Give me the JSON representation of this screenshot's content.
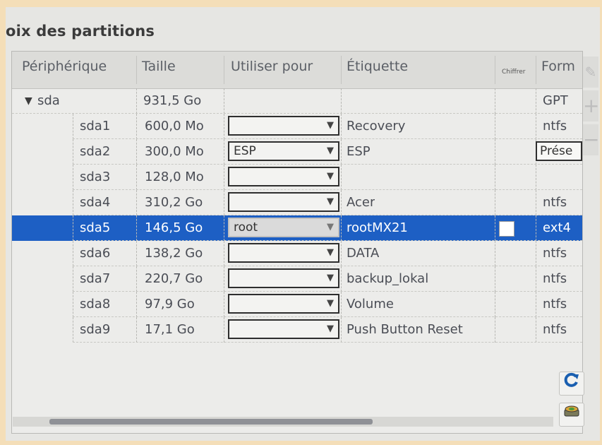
{
  "page_title": "oix des partitions",
  "columns": {
    "device": "Périphérique",
    "size": "Taille",
    "use_for": "Utiliser pour",
    "label": "Étiquette",
    "encrypt": "Chiffrer",
    "format": "Form"
  },
  "disk": {
    "expander": "▼",
    "name": "sda",
    "size": "931,5 Go",
    "format": "GPT"
  },
  "partitions": [
    {
      "name": "sda1",
      "size": "600,0 Mo",
      "use_for": "",
      "label": "Recovery",
      "format": "ntfs"
    },
    {
      "name": "sda2",
      "size": "300,0 Mo",
      "use_for": "ESP",
      "label": "ESP",
      "format": "Prése"
    },
    {
      "name": "sda3",
      "size": "128,0 Mo",
      "use_for": "",
      "label": "",
      "format": ""
    },
    {
      "name": "sda4",
      "size": "310,2 Go",
      "use_for": "",
      "label": "Acer",
      "format": "ntfs"
    },
    {
      "name": "sda5",
      "size": "146,5 Go",
      "use_for": "root",
      "label": "rootMX21",
      "format": "ext4",
      "selected": true
    },
    {
      "name": "sda6",
      "size": "138,2 Go",
      "use_for": "",
      "label": "DATA",
      "format": "ntfs"
    },
    {
      "name": "sda7",
      "size": "220,7 Go",
      "use_for": "",
      "label": "backup_lokal",
      "format": "ntfs"
    },
    {
      "name": "sda8",
      "size": "97,9 Go",
      "use_for": "",
      "label": "Volume",
      "format": "ntfs"
    },
    {
      "name": "sda9",
      "size": "17,1 Go",
      "use_for": "",
      "label": "Push Button Reset",
      "format": "ntfs"
    }
  ],
  "combo_arrow": "▼",
  "side_buttons": {
    "add": "+",
    "remove": "−"
  },
  "icons": {
    "reload": "reload-icon",
    "partition_tool": "drive-manager-icon"
  },
  "colors": {
    "selection": "#1d5fc4",
    "background": "#e6e6e3",
    "frame": "#f4deb8"
  }
}
